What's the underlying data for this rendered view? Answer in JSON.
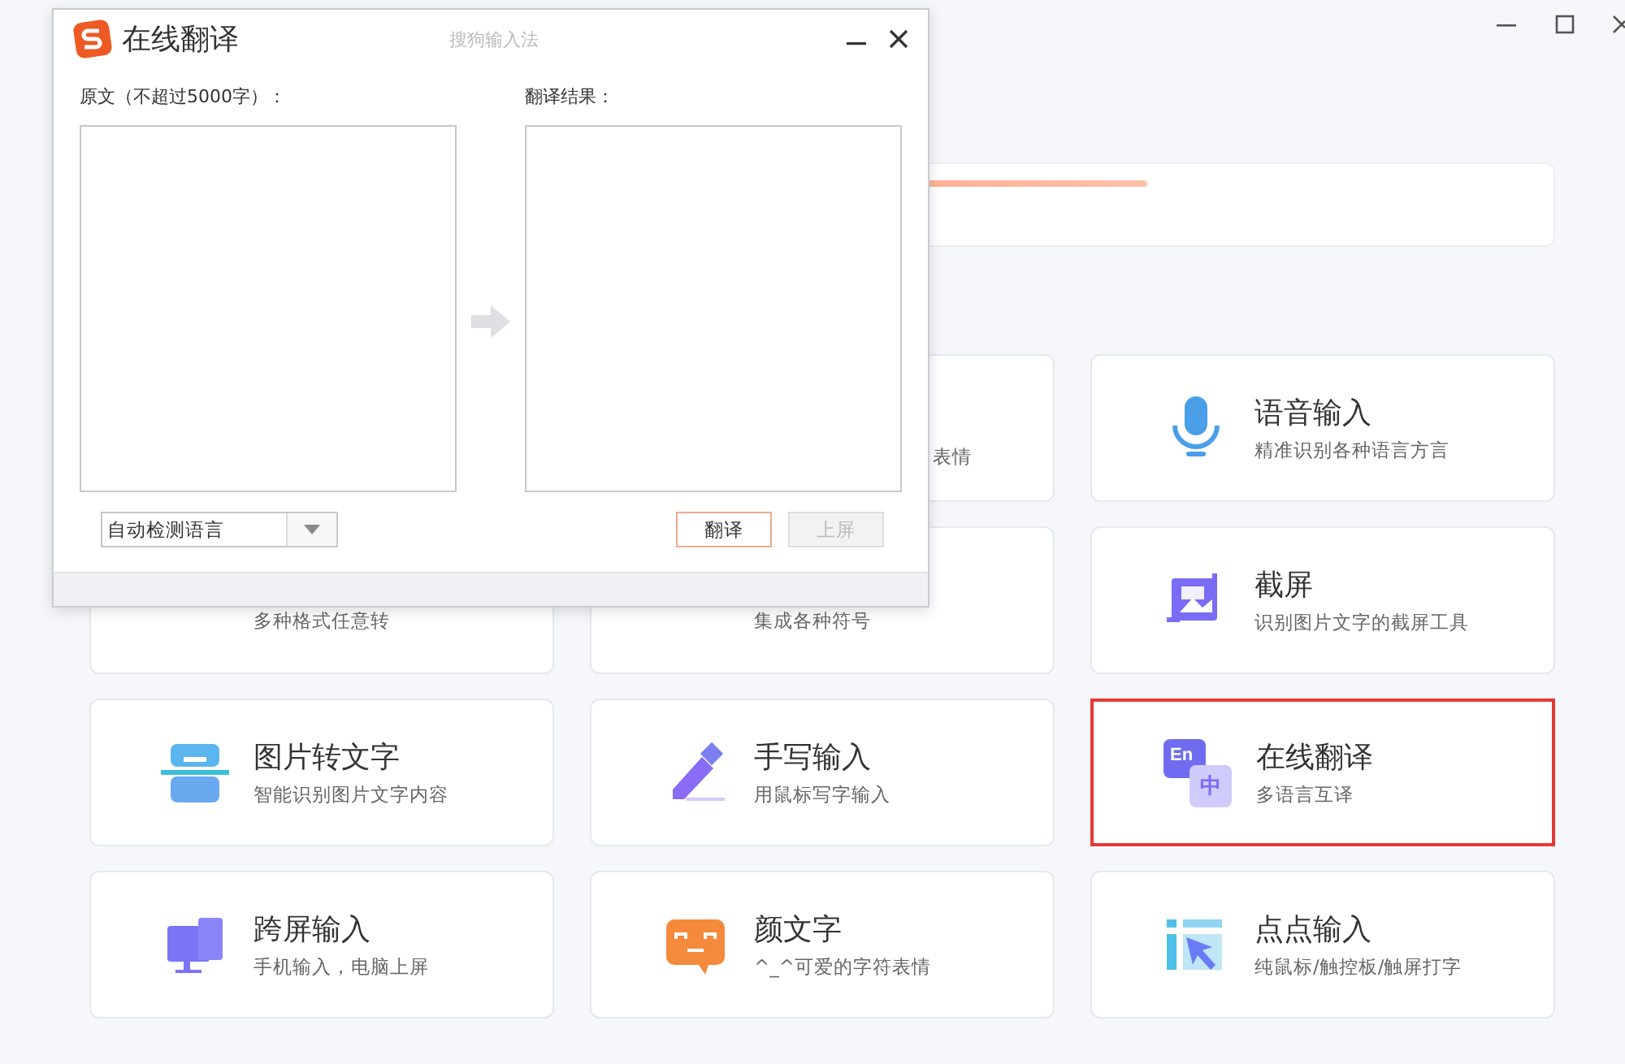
{
  "dialog": {
    "title": "在线翻译",
    "brand": "搜狗输入法",
    "source_label": "原文（不超过5000字）：",
    "result_label": "翻译结果：",
    "language_select": {
      "value": "自动检测语言"
    },
    "buttons": [
      {
        "label": "翻译",
        "disabled": false
      },
      {
        "label": "上屏",
        "disabled": true
      }
    ]
  },
  "features": [
    {
      "kind": "cut",
      "subtitle": "表情",
      "selected": false
    },
    {
      "kind": "full",
      "title": "语音输入",
      "subtitle": "精准识别各种语言方言",
      "selected": false
    },
    {
      "kind": "covered",
      "subtitle": "多种格式任意转",
      "selected": false
    },
    {
      "kind": "covered",
      "subtitle": "集成各种符号",
      "selected": false
    },
    {
      "kind": "full",
      "title": "截屏",
      "subtitle": "识别图片文字的截屏工具",
      "selected": false
    },
    {
      "kind": "full",
      "title": "图片转文字",
      "subtitle": "智能识别图片文字内容",
      "selected": false
    },
    {
      "kind": "full",
      "title": "手写输入",
      "subtitle": "用鼠标写字输入",
      "selected": false
    },
    {
      "kind": "full",
      "title": "在线翻译",
      "subtitle": "多语言互译",
      "icon_labels": [
        "En",
        "中"
      ],
      "selected": true
    },
    {
      "kind": "full",
      "title": "跨屏输入",
      "subtitle": "手机输入，电脑上屏",
      "selected": false
    },
    {
      "kind": "full",
      "title": "颜文字",
      "subtitle": "^_^可爱的字符表情",
      "selected": false
    },
    {
      "kind": "full",
      "title": "点点输入",
      "subtitle": "纯鼠标/触控板/触屏打字",
      "selected": false
    }
  ]
}
